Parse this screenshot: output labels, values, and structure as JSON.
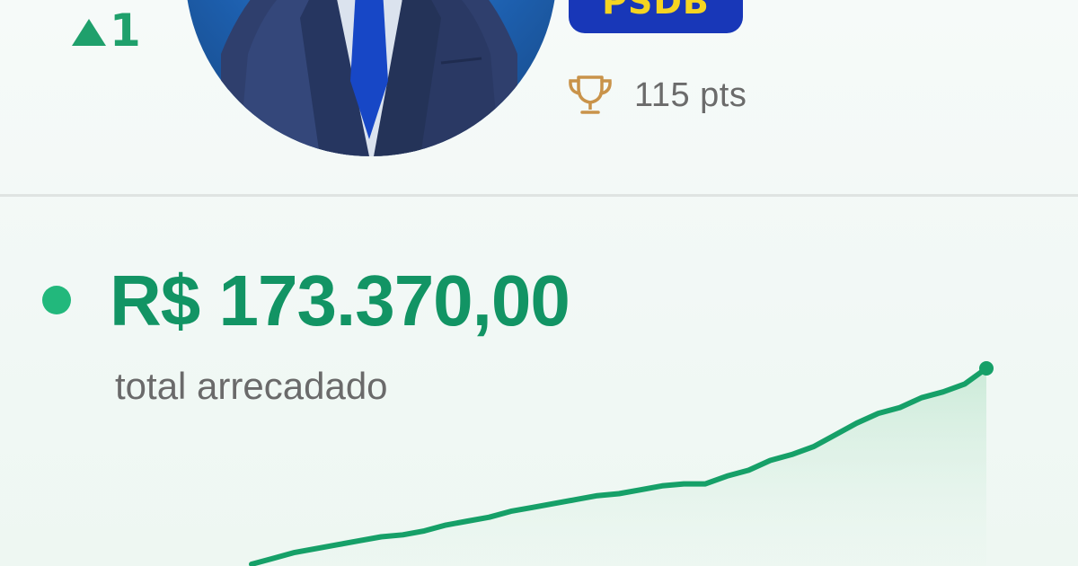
{
  "ranking": {
    "position_change": "1",
    "direction_icon": "triangle-up-icon"
  },
  "politician": {
    "party": "PSDB",
    "points": "115 pts",
    "points_icon": "trophy-icon"
  },
  "fundraising": {
    "total_value": "R$ 173.370,00",
    "total_label": "total arrecadado"
  },
  "colors": {
    "accent_green": "#129464",
    "party_badge_bg": "#1837b8",
    "party_badge_text": "#f5d421",
    "trophy": "#c9934a"
  },
  "chart_data": {
    "type": "area",
    "title": "",
    "xlabel": "",
    "ylabel": "",
    "series": [
      {
        "values": [
          0.0,
          0.03,
          0.06,
          0.08,
          0.1,
          0.12,
          0.14,
          0.15,
          0.17,
          0.2,
          0.22,
          0.24,
          0.27,
          0.29,
          0.31,
          0.33,
          0.35,
          0.36,
          0.38,
          0.4,
          0.41,
          0.41,
          0.45,
          0.48,
          0.53,
          0.56,
          0.6,
          0.66,
          0.72,
          0.77,
          0.8,
          0.85,
          0.88,
          0.92,
          1.0
        ]
      }
    ],
    "grid": false,
    "legend": "none"
  }
}
